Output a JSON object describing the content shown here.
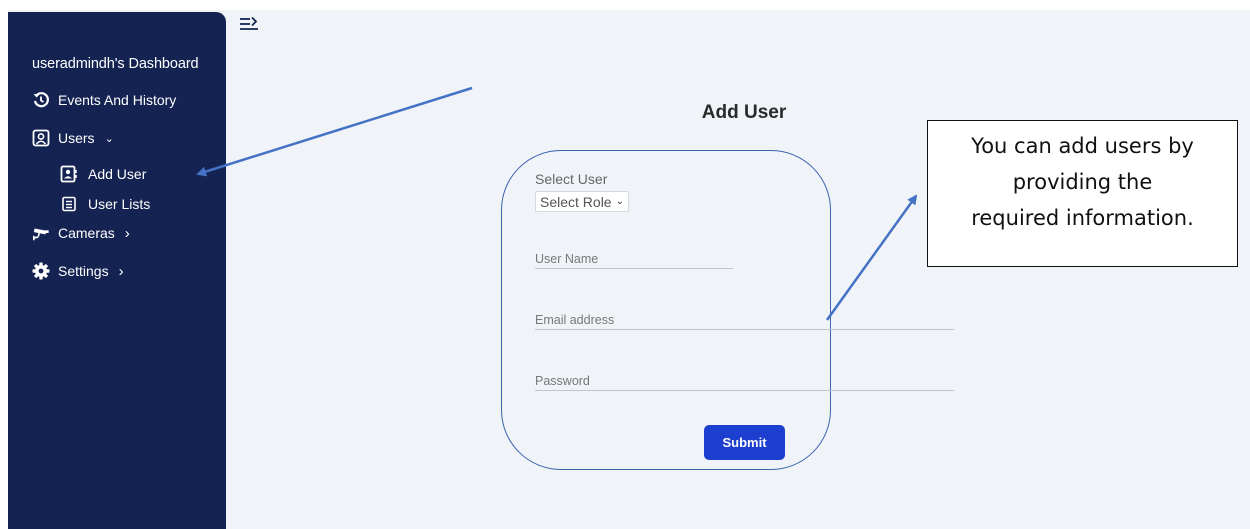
{
  "sidebar": {
    "title": "useradmindh's Dashboard",
    "items": [
      {
        "label": "Events And History",
        "icon": "history-icon"
      },
      {
        "label": "Users",
        "icon": "user-square-icon",
        "chevron": "⌄"
      },
      {
        "label": "Add User",
        "icon": "contact-card-icon"
      },
      {
        "label": "User Lists",
        "icon": "list-icon"
      },
      {
        "label": "Cameras",
        "icon": "cctv-camera-icon",
        "chevron": "›"
      },
      {
        "label": "Settings",
        "icon": "gear-icon",
        "chevron": "›"
      }
    ]
  },
  "header": {
    "toggle_icon": "sidebar-toggle-icon"
  },
  "form": {
    "title": "Add User",
    "select_label": "Select User",
    "role_select_value": "Select Role",
    "username_placeholder": "User Name",
    "email_placeholder": "Email address",
    "password_placeholder": "Password",
    "submit_label": "Submit"
  },
  "annotation": {
    "callout_lines": [
      "You can add users by",
      "providing the",
      "required information."
    ],
    "arrow_color": "#4472c4"
  },
  "colors": {
    "sidebar_bg": "#142352",
    "page_bg": "#f0f3f8",
    "accent": "#1c3fcf",
    "card_border": "#3b63b0"
  }
}
